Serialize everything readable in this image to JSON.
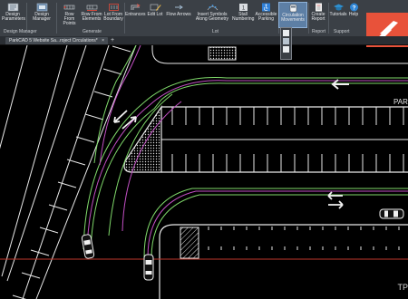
{
  "ribbon": {
    "buttons": [
      {
        "label": "Design Parameters",
        "icon": "parameters-icon"
      },
      {
        "label": "Design Manager",
        "icon": "manager-icon"
      },
      {
        "label": "Row From Points",
        "icon": "row-points-icon"
      },
      {
        "label": "Row From Elements",
        "icon": "row-elements-icon"
      },
      {
        "label": "Lot From Boundary",
        "icon": "boundary-icon"
      },
      {
        "label": "Entrances",
        "icon": "entrance-icon"
      },
      {
        "label": "Edit Lot",
        "icon": "edit-lot-icon"
      },
      {
        "label": "Flow Arrows",
        "icon": "flow-arrow-icon"
      },
      {
        "label": "Insert Symbols Along Geometry",
        "icon": "symbols-icon"
      },
      {
        "label": "Stall Numbering",
        "icon": "numbering-icon"
      },
      {
        "label": "Accessible Parking",
        "icon": "accessible-icon"
      },
      {
        "label": "Circulation Movements",
        "icon": "circulation-icon"
      },
      {
        "label": "Create Report",
        "icon": "report-icon"
      },
      {
        "label": "Tutorials",
        "icon": "tutorials-icon"
      },
      {
        "label": "Help",
        "icon": "help-icon"
      }
    ],
    "groups": [
      "Design Manager",
      "Generate",
      "Lot",
      "Report",
      "Support"
    ]
  },
  "tab": {
    "title": "ParkCAD 5 Website Sa...roject Circulations*",
    "close": "×",
    "add": "+"
  },
  "corner_text": "TP",
  "watermark": "PAR",
  "colors": {
    "ribbon": "#3b4046",
    "active": "#5d7fa5",
    "accent": "#e8523a",
    "green_path": "#7fd86a",
    "magenta_path": "#c24fc4"
  }
}
